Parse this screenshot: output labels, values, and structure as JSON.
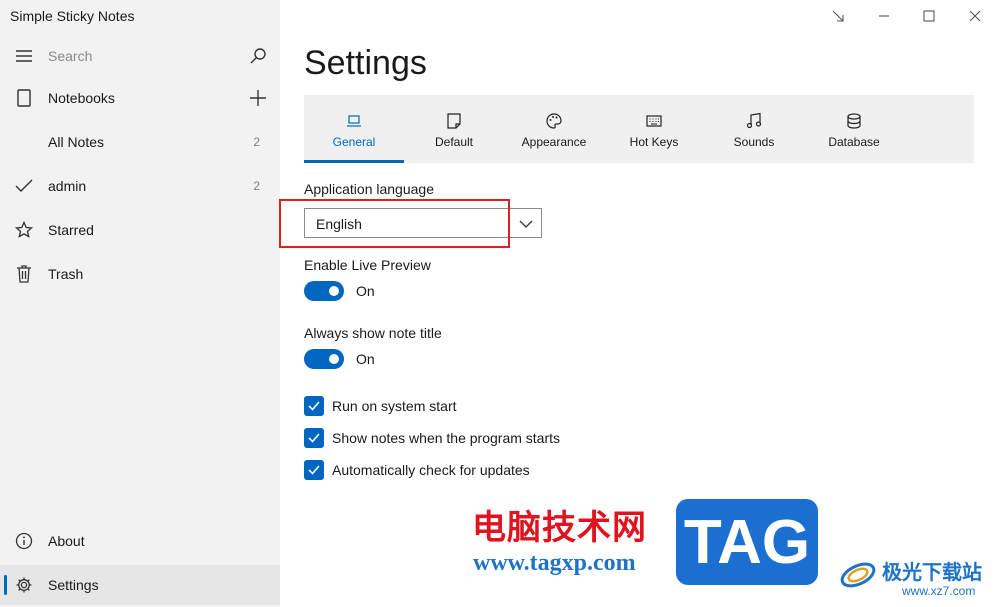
{
  "app": {
    "title": "Simple Sticky Notes"
  },
  "sidebar": {
    "search_placeholder": "Search",
    "notebooks": "Notebooks",
    "all_notes": {
      "label": "All Notes",
      "count": "2"
    },
    "admin": {
      "label": "admin",
      "count": "2"
    },
    "starred": "Starred",
    "trash": "Trash",
    "about": "About",
    "settings": "Settings"
  },
  "icons": {
    "menu": "hamburger-icon",
    "search": "search-icon",
    "notebook": "notebook-icon",
    "add": "plus-icon",
    "check": "checkmark-icon",
    "star": "star-icon",
    "trash": "trash-icon",
    "info": "info-icon",
    "gear": "gear-icon"
  },
  "page": {
    "title": "Settings"
  },
  "tabs": [
    {
      "label": "General",
      "icon": "laptop-icon",
      "active": true
    },
    {
      "label": "Default",
      "icon": "note-icon"
    },
    {
      "label": "Appearance",
      "icon": "palette-icon"
    },
    {
      "label": "Hot Keys",
      "icon": "keyboard-icon"
    },
    {
      "label": "Sounds",
      "icon": "music-icon"
    },
    {
      "label": "Database",
      "icon": "database-icon"
    }
  ],
  "general": {
    "language_label": "Application language",
    "language_value": "English",
    "live_preview_label": "Enable Live Preview",
    "live_preview_state": "On",
    "note_title_label": "Always show note title",
    "note_title_state": "On",
    "checkboxes": [
      {
        "label": "Run on system start",
        "checked": true
      },
      {
        "label": "Show notes when the program starts",
        "checked": true
      },
      {
        "label": "Automatically check for updates",
        "checked": true
      }
    ]
  },
  "watermark": {
    "cn_text": "电脑技术网",
    "url": "www.tagxp.com",
    "tag": "TAG",
    "cn_text2": "极光下载站",
    "url2": "www.xz7.com"
  },
  "colors": {
    "accent": "#0067c0",
    "highlight": "#e02020",
    "sidebar_bg": "#f2f2f2"
  }
}
